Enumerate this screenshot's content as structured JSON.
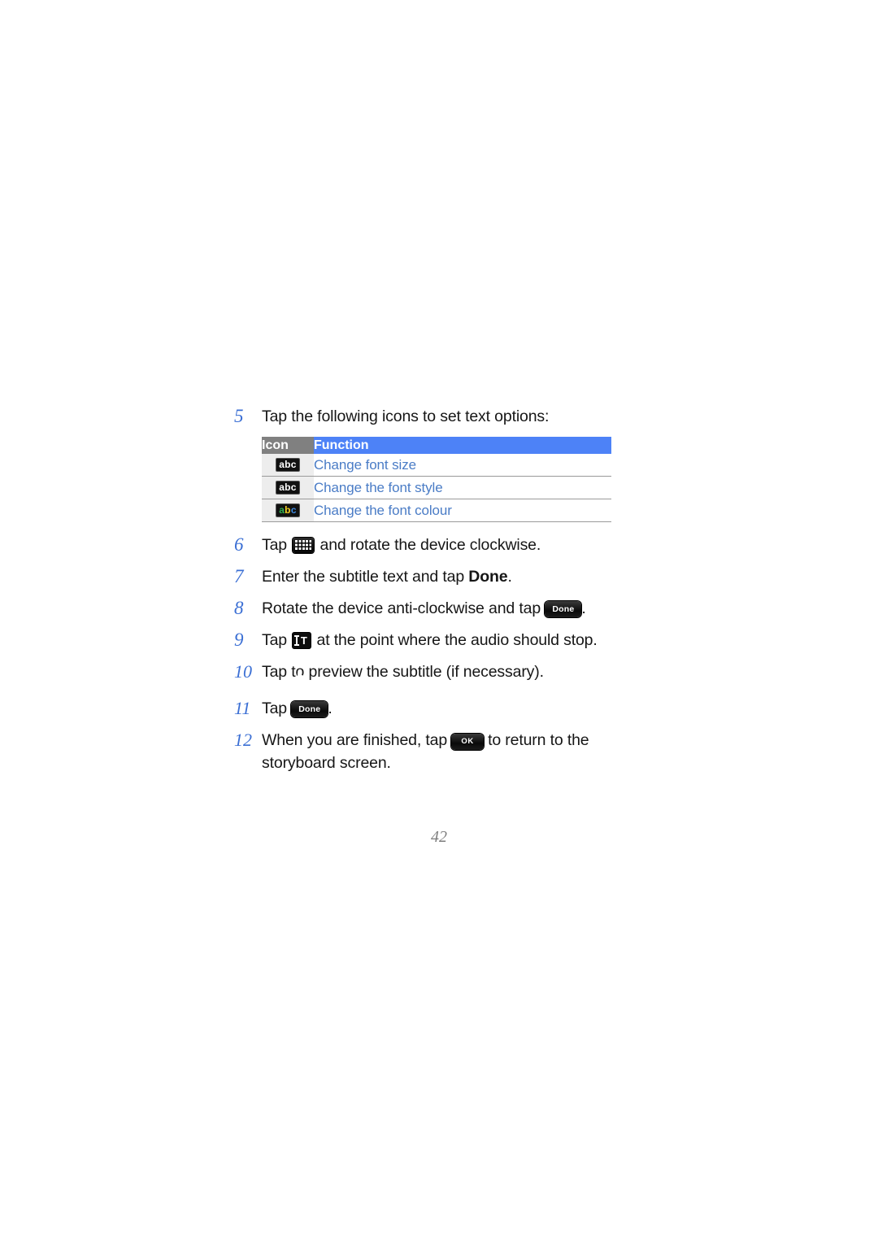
{
  "page": {
    "number": "42"
  },
  "steps": [
    {
      "num": "5",
      "text_before": "Tap the following icons to set text options:",
      "icon": "",
      "text_after": ""
    },
    {
      "num": "6",
      "text_before": "Tap ",
      "icon": "keyboard-icon",
      "text_after": " and rotate the device clockwise."
    },
    {
      "num": "7",
      "text_before": "Enter the subtitle text and tap ",
      "bold": "Done",
      "text_after": "."
    },
    {
      "num": "8",
      "text_before": "Rotate the device anti-clockwise and tap ",
      "icon": "done-button-icon",
      "icon_label": "Done",
      "text_after": "."
    },
    {
      "num": "9",
      "text_before": "Tap ",
      "icon": "text-cursor-icon",
      "text_after": " at the point where the audio should stop."
    },
    {
      "num": "10",
      "text_before": "Tap ",
      "icon": "play-icon",
      "text_after": " to preview the subtitle (if necessary)."
    },
    {
      "num": "11",
      "text_before": "Tap ",
      "icon": "done-button-icon",
      "icon_label": "Done",
      "text_after": "."
    },
    {
      "num": "12",
      "text_before": "When you are finished, tap ",
      "icon": "ok-button-icon",
      "icon_label": "OK",
      "text_after": " to return to the storyboard screen."
    }
  ],
  "table": {
    "headers": {
      "icon": "Icon",
      "function": "Function"
    },
    "rows": [
      {
        "icon": "abc-mono-icon",
        "icon_text": "abc",
        "function": "Change font size"
      },
      {
        "icon": "abc-mono-icon",
        "icon_text": "abc",
        "function": "Change the font style"
      },
      {
        "icon": "abc-colour-icon",
        "icon_text": "abc",
        "function": "Change the font colour"
      }
    ]
  },
  "colors": {
    "header_icon_bg": "#808080",
    "header_function_bg": "#4d82f7",
    "link_text": "#4a7cc6",
    "step_number": "#3b6fd4",
    "row_icon_bg": "#ededed"
  }
}
